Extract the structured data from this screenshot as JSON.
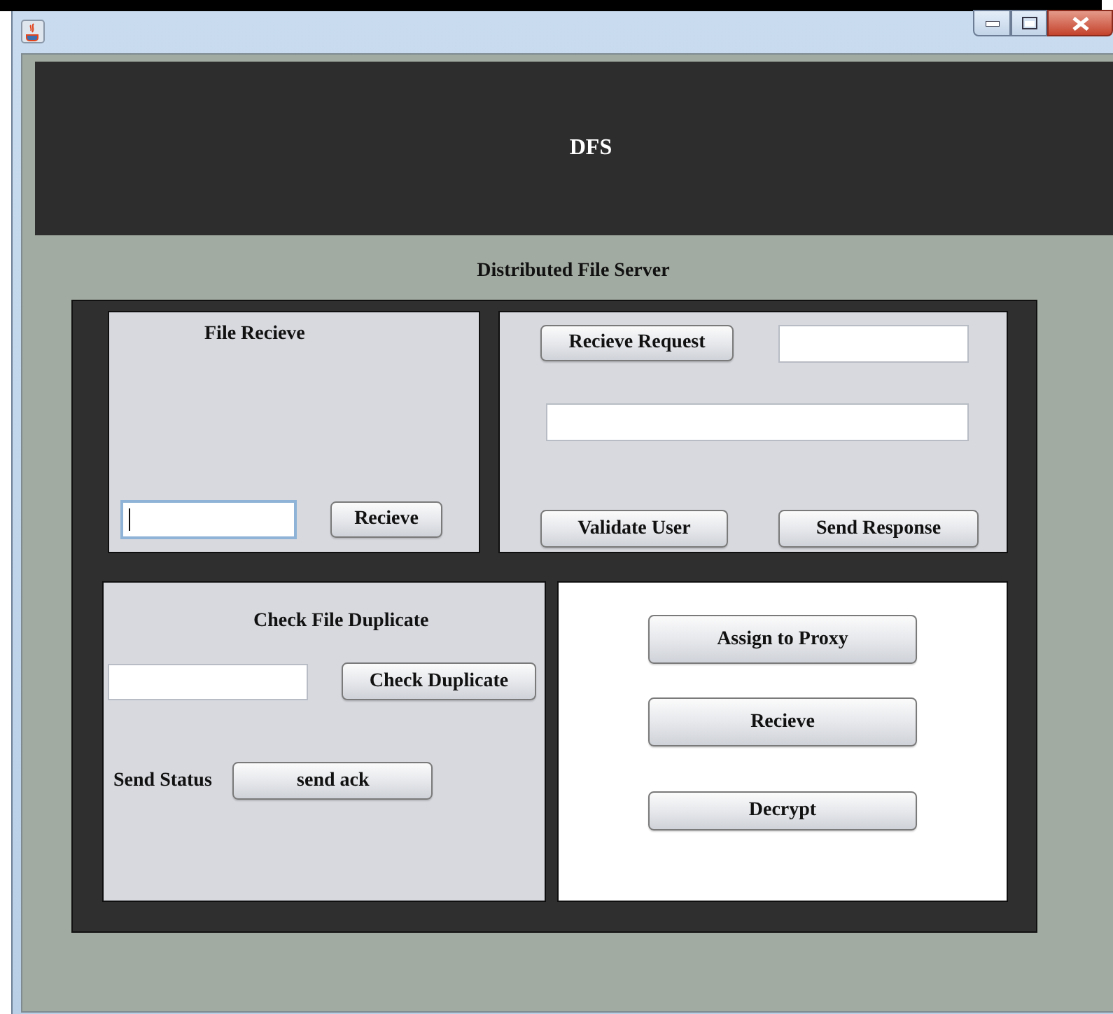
{
  "header": {
    "title": "DFS"
  },
  "subtitle": "Distributed File Server",
  "file_receive": {
    "title": "File Recieve",
    "field": {
      "focused": true
    },
    "button": "Recieve"
  },
  "request_panel": {
    "receive_button": "Recieve Request",
    "request_field": {
      "focused": false
    },
    "user_field": {
      "focused": false
    },
    "validate_button": "Validate User",
    "response_button": "Send Response"
  },
  "duplicate_panel": {
    "title": "Check File Duplicate",
    "field": {
      "focused": false
    },
    "check_button": "Check Duplicate",
    "status_label": "Send Status",
    "ack_button": "send ack"
  },
  "proxy_panel": {
    "buttons": [
      "Assign to Proxy",
      "Recieve",
      "Decrypt"
    ]
  }
}
